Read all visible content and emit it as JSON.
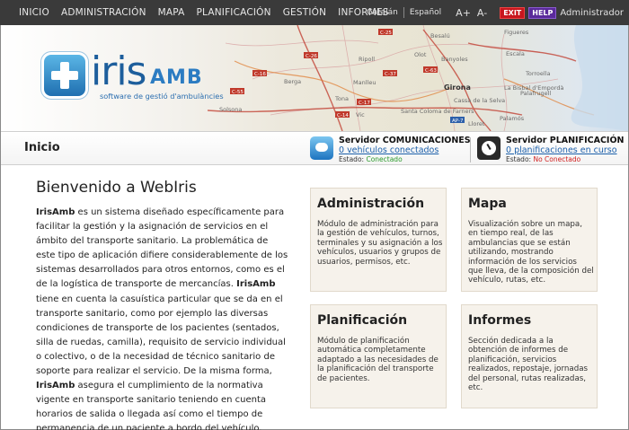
{
  "nav": {
    "items": [
      "INICIO",
      "ADMINISTRACIÓN",
      "MAPA",
      "PLANIFICACIÓN",
      "GESTIÓN",
      "INFORMES"
    ],
    "languages": [
      "Catalán",
      "Español"
    ],
    "font_increase": "A+",
    "font_decrease": "A-",
    "exit_label": "EXIT",
    "help_label": "HELP",
    "user_label": "Administrador"
  },
  "banner": {
    "logo_main": "iris",
    "logo_amb": "AMB",
    "logo_tagline": "software de gestió d'ambulàncies",
    "map_labels": [
      "Berga",
      "Solsona",
      "Ripoll",
      "Vic",
      "Manlleu",
      "Olot",
      "Besalú",
      "Figueres",
      "Girona",
      "Banyoles",
      "Santa Coloma de Farners",
      "Palafrugell",
      "Palamós",
      "Escala",
      "La Bisbal d'Empordà",
      "Torroella",
      "Cassà de la Selva",
      "Tona",
      "Lloret",
      "C-25",
      "C-26",
      "C-17",
      "C-37",
      "C-63",
      "AP-7",
      "C-16",
      "C-14",
      "C-55"
    ]
  },
  "status": {
    "page_title": "Inicio",
    "comms": {
      "name": "Servidor COMUNICACIONES",
      "link": "0 vehículos conectados",
      "state_label": "Estado:",
      "state_value": "Conectado",
      "color": "#2a9a2a"
    },
    "planning": {
      "name": "Servidor PLANIFICACIÓN",
      "link": "0 planificaciones en curso",
      "state_label": "Estado:",
      "state_value": "No Conectado",
      "color": "#d02020"
    }
  },
  "main": {
    "welcome_title": "Bienvenido a WebIris",
    "intro": [
      {
        "b": "IrisAmb",
        "t": " es un sistema diseñado específicamente para facilitar la gestión y la asignación de servicios en el ámbito del transporte sanitario. La problemática de este tipo de aplicación difiere considerablemente de los sistemas desarrollados para otros entornos, como es el de la logística de transporte de mercancías. "
      },
      {
        "b": "IrisAmb",
        "t": " tiene en cuenta la casuística particular que se da en el transporte sanitario, como por ejemplo las diversas condiciones de transporte de los pacientes (sentados, silla de ruedas, camilla), requisito de servicio individual o colectivo, o de la necesidad de técnico sanitario de soporte para realizar el servicio. De la misma forma, "
      },
      {
        "b": "IrisAmb",
        "t": " asegura el cumplimiento de la normativa vigente en transporte sanitario teniendo en cuenta horarios de salida o llegada así como el tiempo de permanencia de un paciente a bordo del vehículo."
      }
    ],
    "cards": [
      {
        "title": "Administración",
        "text": "Módulo de administración para la gestión de vehículos, turnos, terminales y su asignación a los vehículos, usuarios y grupos de usuarios, permisos, etc."
      },
      {
        "title": "Mapa",
        "text": "Visualización sobre un mapa, en tiempo real, de las ambulancias que se están utilizando, mostrando información de los servicios que lleva, de la composición del vehículo, rutas, etc."
      },
      {
        "title": "Planificación",
        "text": "Módulo de planificación automática completamente adaptado a las necesidades de la planificación del transporte de pacientes."
      },
      {
        "title": "Informes",
        "text": "Sección dedicada a la obtención de informes de planificación, servicios realizados, repostaje, jornadas del personal, rutas realizadas, etc."
      }
    ]
  }
}
